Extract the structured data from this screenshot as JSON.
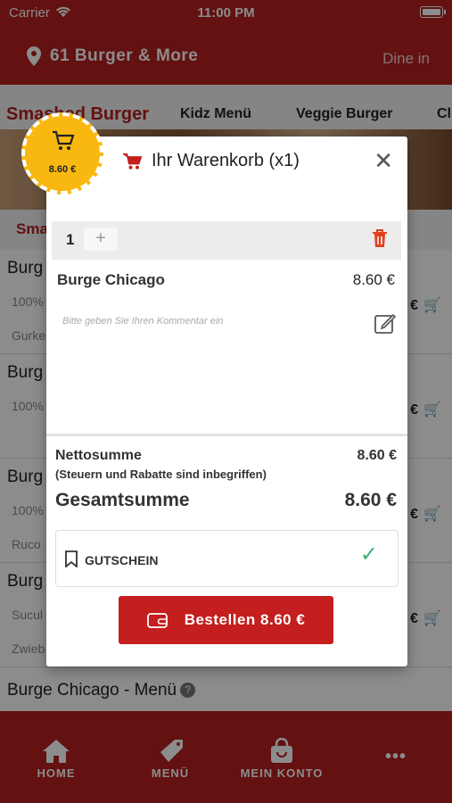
{
  "status": {
    "carrier": "Carrier",
    "time": "11:00 PM"
  },
  "header": {
    "location": "61 Burger & More",
    "dine_in": "Dine in"
  },
  "categories": [
    "Smashed Burger",
    "Kidz Menü",
    "Veggie Burger",
    "Cl"
  ],
  "subcategory": "Sma",
  "menu_rows": [
    {
      "name": "Burg",
      "desc": "100%",
      "desc2": "Gurke",
      "price": "0 €"
    },
    {
      "name": "Burg",
      "desc": "100%",
      "desc2": "",
      "price": "0 €"
    },
    {
      "name": "Burg",
      "desc": "100%",
      "desc2": "Ruco",
      "price": "0 €"
    },
    {
      "name": "Burg",
      "desc": "Sucul",
      "desc2": "Zwieb",
      "price": "0 €"
    }
  ],
  "last_row": {
    "name": "Burge Chicago - Menü",
    "help": "?"
  },
  "tabs": {
    "home": "HOME",
    "menu": "MENÜ",
    "account": "MEIN KONTO",
    "more": "•••"
  },
  "badge": {
    "price": "8.60 €"
  },
  "cart": {
    "title": "Ihr Warenkorb (x1)",
    "quantity": "1",
    "plus": "+",
    "item_name": "Burge Chicago",
    "item_price": "8.60 €",
    "comment_placeholder": "Bitte geben Sie Ihren Kommentar ein",
    "net_label": "Nettosumme",
    "net_value": "8.60 €",
    "tax_note": "(Steuern und Rabatte sind inbegriffen)",
    "total_label": "Gesamtsumme",
    "total_value": "8.60 €",
    "voucher_label": "GUTSCHEIN",
    "order_button": "Bestellen 8.60 €",
    "close": "✕"
  },
  "colors": {
    "brand_red": "#b41f1f",
    "badge_yellow": "#f9b80f",
    "success_green": "#3cb371"
  }
}
